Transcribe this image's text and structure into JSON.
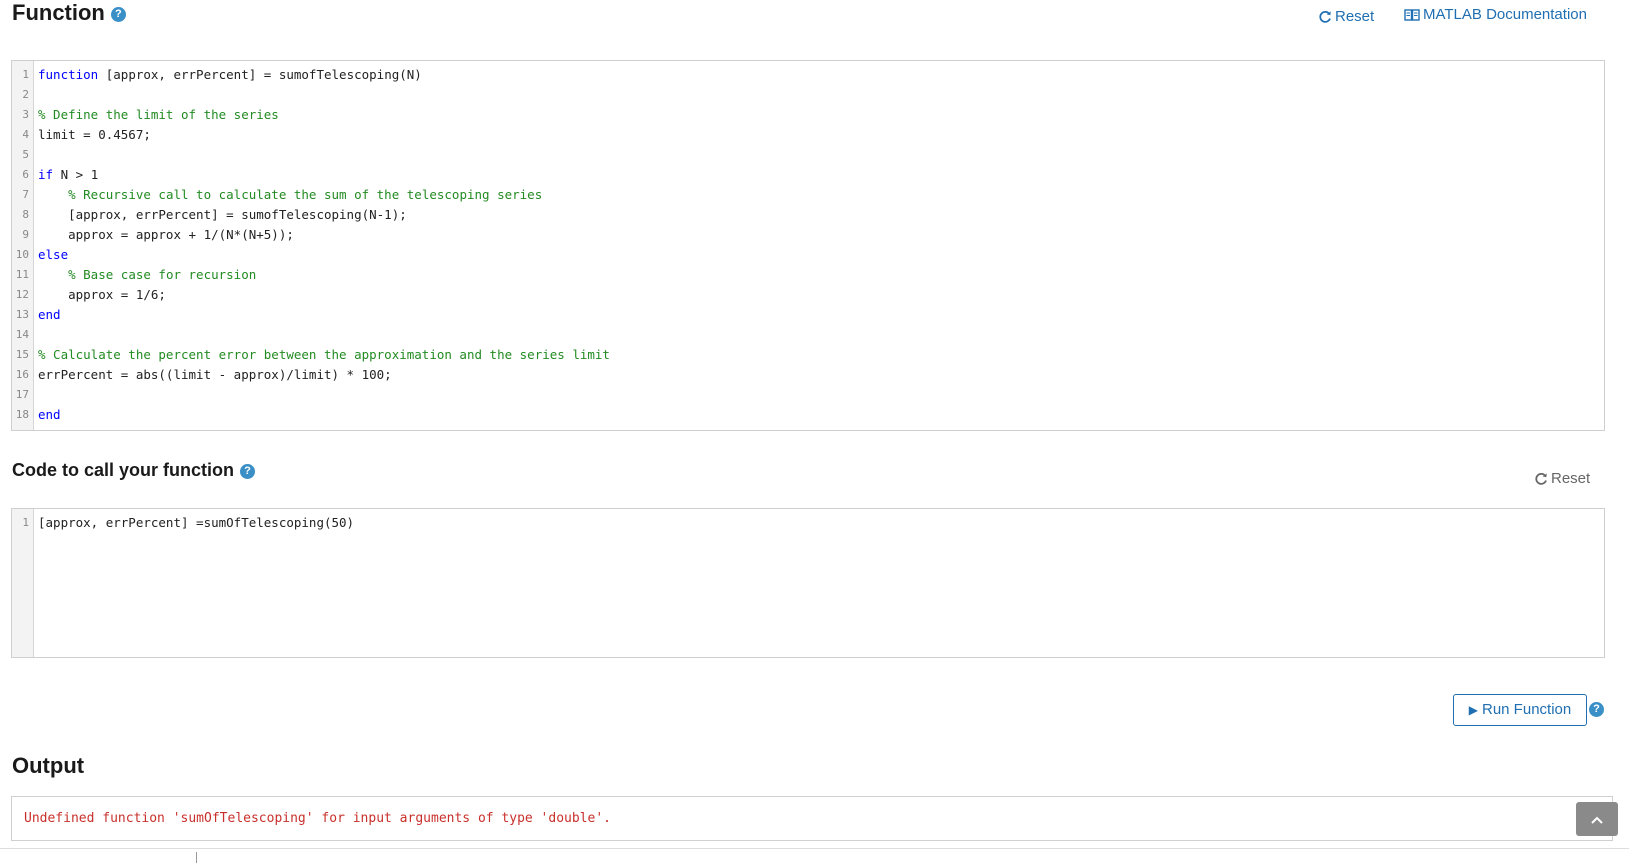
{
  "function_section": {
    "title": "Function",
    "help_icon": "question-circle-icon",
    "reset_label": "Reset",
    "doc_label": "MATLAB Documentation",
    "code_lines": [
      {
        "n": "1",
        "tokens": [
          {
            "t": "function",
            "c": "kw"
          },
          {
            "t": " [approx, errPercent] = sumofTelescoping(N)",
            "c": ""
          }
        ]
      },
      {
        "n": "2",
        "tokens": []
      },
      {
        "n": "3",
        "tokens": [
          {
            "t": "% Define the limit of the series",
            "c": "cm"
          }
        ]
      },
      {
        "n": "4",
        "tokens": [
          {
            "t": "limit = 0.4567;",
            "c": ""
          }
        ]
      },
      {
        "n": "5",
        "tokens": []
      },
      {
        "n": "6",
        "tokens": [
          {
            "t": "if",
            "c": "kw"
          },
          {
            "t": " N > 1",
            "c": ""
          }
        ]
      },
      {
        "n": "7",
        "tokens": [
          {
            "t": "    ",
            "c": ""
          },
          {
            "t": "% Recursive call to calculate the sum of the telescoping series",
            "c": "cm"
          }
        ]
      },
      {
        "n": "8",
        "tokens": [
          {
            "t": "    [approx, errPercent] = sumofTelescoping(N-1);",
            "c": ""
          }
        ]
      },
      {
        "n": "9",
        "tokens": [
          {
            "t": "    approx = approx + 1/(N*(N+5));",
            "c": ""
          }
        ]
      },
      {
        "n": "10",
        "tokens": [
          {
            "t": "else",
            "c": "kw"
          }
        ]
      },
      {
        "n": "11",
        "tokens": [
          {
            "t": "    ",
            "c": ""
          },
          {
            "t": "% Base case for recursion",
            "c": "cm"
          }
        ]
      },
      {
        "n": "12",
        "tokens": [
          {
            "t": "    approx = 1/6;",
            "c": ""
          }
        ]
      },
      {
        "n": "13",
        "tokens": [
          {
            "t": "end",
            "c": "kw"
          }
        ]
      },
      {
        "n": "14",
        "tokens": []
      },
      {
        "n": "15",
        "tokens": [
          {
            "t": "% Calculate the percent error between the approximation and the series limit",
            "c": "cm"
          }
        ]
      },
      {
        "n": "16",
        "tokens": [
          {
            "t": "errPercent = abs((limit - approx)/limit) * 100;",
            "c": ""
          }
        ]
      },
      {
        "n": "17",
        "tokens": []
      },
      {
        "n": "18",
        "tokens": [
          {
            "t": "end",
            "c": "kw"
          }
        ]
      }
    ]
  },
  "call_section": {
    "title": "Code to call your function",
    "help_icon": "question-circle-icon",
    "reset_label": "Reset",
    "code_lines": [
      {
        "n": "1",
        "tokens": [
          {
            "t": "[approx, errPercent] =sumOfTelescoping(50)",
            "c": ""
          }
        ]
      }
    ]
  },
  "run": {
    "label": "Run Function",
    "icon": "play-icon",
    "help_icon": "question-circle-icon"
  },
  "output": {
    "title": "Output",
    "message": "Undefined function 'sumOfTelescoping' for input arguments of type 'double'."
  },
  "scroll_top_icon": "chevron-up-icon",
  "colors": {
    "link": "#1f6fb2",
    "keyword": "#0000ff",
    "comment": "#228b22",
    "error": "#c9302c",
    "help": "#3a8fc7"
  }
}
